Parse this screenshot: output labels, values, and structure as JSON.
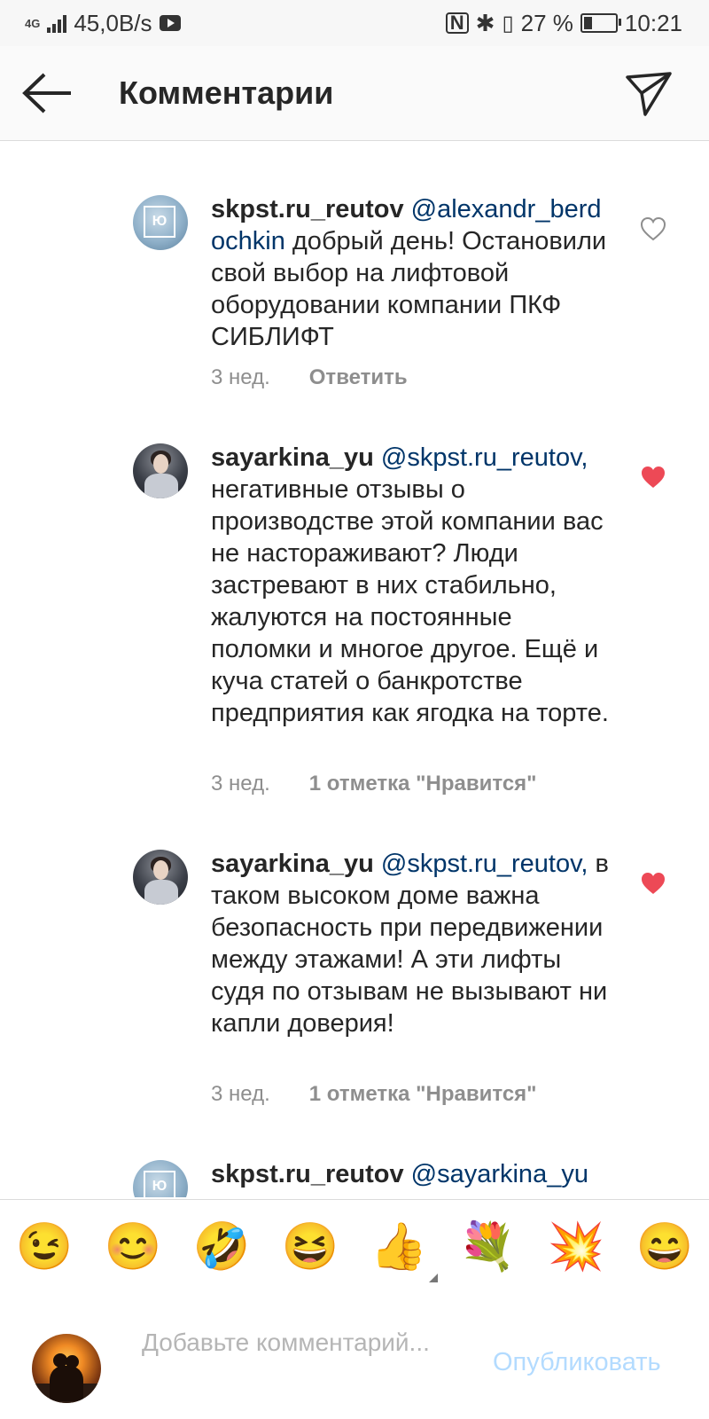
{
  "status_bar": {
    "network": "4G",
    "speed": "45,0B/s",
    "battery": "27 %",
    "battery_level": 0.27,
    "time": "10:21"
  },
  "header": {
    "title": "Комментарии"
  },
  "comments": [
    {
      "username": "skpst.ru_reutov",
      "mention": "@alexandr_berdochkin",
      "text": "добрый день! Остановили свой выбор на лифтовой оборудовании компании ПКФ СИБЛИФТ",
      "time": "3 нед.",
      "action": "Ответить",
      "liked": false
    },
    {
      "username": "sayarkina_yu",
      "mention": "@skpst.ru_reutov,",
      "text": "негативные отзывы о производстве этой компании вас не настораживают? Люди застревают в них стабильно, жалуются на постоянные поломки и многое другое. Ещё и куча статей о банкротстве предприятия как ягодка на торте.",
      "time": "3 нед.",
      "action": "1 отметка \"Нравится\"",
      "liked": true,
      "heart_color": "#ed4956"
    },
    {
      "username": "sayarkina_yu",
      "mention": "@skpst.ru_reutov,",
      "text": "в таком высоком доме важна безопасность при передвижении между этажами! А эти лифты судя по отзывам не вызывают ни капли доверия!",
      "time": "3 нед.",
      "action": "1 отметка \"Нравится\"",
      "liked": true,
      "heart_color": "#ed4956"
    },
    {
      "username": "skpst.ru_reutov",
      "mention": "@sayarkina_yu",
      "text": "",
      "partial": true
    }
  ],
  "emoji_bar": [
    "😉",
    "😊",
    "🤣",
    "😆",
    "👍",
    "💐",
    "💥",
    "😄"
  ],
  "composer": {
    "placeholder": "Добавьте комментарий...",
    "publish_label": "Опубликовать",
    "publish_color": "#b3dbff"
  }
}
